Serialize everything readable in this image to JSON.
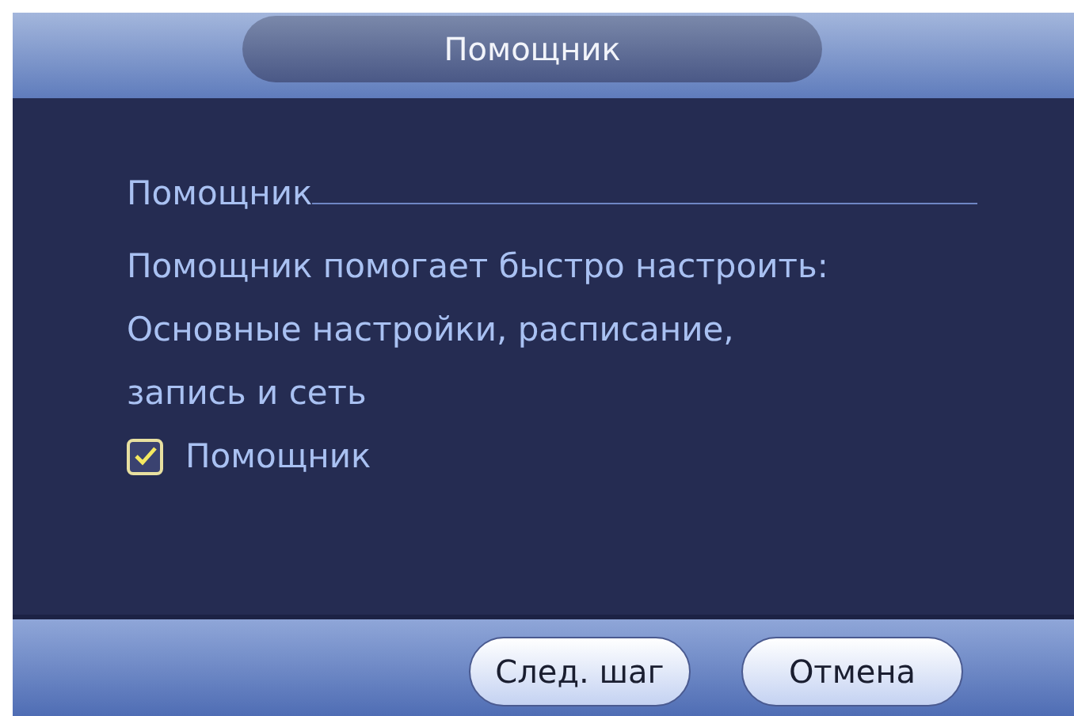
{
  "window": {
    "title": "Помощник"
  },
  "section": {
    "label": "Помощник"
  },
  "description": [
    "Помощник помогает быстро настроить:",
    "Основные настройки, расписание,",
    "запись и сеть"
  ],
  "checkbox": {
    "label": "Помощник",
    "checked": true
  },
  "buttons": [
    {
      "label": "След. шаг"
    },
    {
      "label": "Отмена"
    }
  ]
}
